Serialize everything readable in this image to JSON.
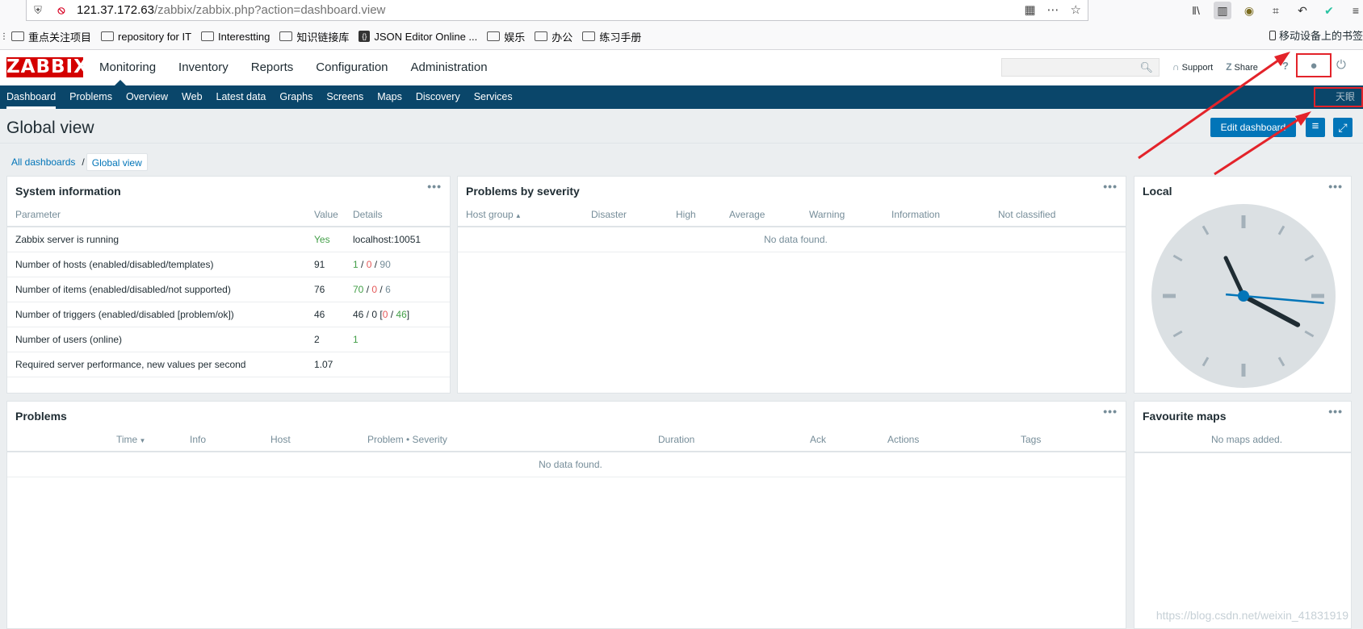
{
  "browser": {
    "url_host": "121.37.172.63",
    "url_path": "/zabbix/zabbix.php?action=dashboard.view",
    "bookmarks": [
      "重点关注项目",
      "repository for IT",
      "Interestting",
      "知识链接库",
      "JSON Editor Online ...",
      "娱乐",
      "办公",
      "练习手册"
    ],
    "mobile_bookmarks": "移动设备上的书签"
  },
  "header": {
    "logo": "ZABBIX",
    "menu": [
      "Monitoring",
      "Inventory",
      "Reports",
      "Configuration",
      "Administration"
    ],
    "support": "Support",
    "share": "Share",
    "help": "?"
  },
  "subnav": {
    "items": [
      "Dashboard",
      "Problems",
      "Overview",
      "Web",
      "Latest data",
      "Graphs",
      "Screens",
      "Maps",
      "Discovery",
      "Services"
    ],
    "server_name": "天眼"
  },
  "page": {
    "title": "Global view",
    "edit_button": "Edit dashboard",
    "breadcrumb": [
      "All dashboards",
      "Global view"
    ]
  },
  "system_info": {
    "title": "System information",
    "headers": [
      "Parameter",
      "Value",
      "Details"
    ],
    "rows": [
      {
        "param": "Zabbix server is running",
        "value": "Yes",
        "details": "localhost:10051"
      },
      {
        "param": "Number of hosts (enabled/disabled/templates)",
        "value": "91",
        "d1": "1",
        "d2": "0",
        "d3": "90"
      },
      {
        "param": "Number of items (enabled/disabled/not supported)",
        "value": "76",
        "d1": "70",
        "d2": "0",
        "d3": "6"
      },
      {
        "param": "Number of triggers (enabled/disabled [problem/ok])",
        "value": "46",
        "d0": "46 / 0 [",
        "d1": "0",
        "d2": "46",
        "d4": "]"
      },
      {
        "param": "Number of users (online)",
        "value": "2",
        "d1": "1"
      },
      {
        "param": "Required server performance, new values per second",
        "value": "1.07",
        "details": ""
      }
    ]
  },
  "problems_by_severity": {
    "title": "Problems by severity",
    "headers": [
      "Host group",
      "Disaster",
      "High",
      "Average",
      "Warning",
      "Information",
      "Not classified"
    ],
    "empty": "No data found."
  },
  "local_clock": {
    "title": "Local",
    "hour_angle_deg": 118,
    "minute_angle_deg": -25,
    "second_angle_deg": 95
  },
  "problems": {
    "title": "Problems",
    "headers": [
      "Time",
      "Info",
      "Host",
      "Problem • Severity",
      "Duration",
      "Ack",
      "Actions",
      "Tags"
    ],
    "empty": "No data found."
  },
  "favourite_maps": {
    "title": "Favourite maps",
    "empty": "No maps added."
  },
  "watermark": "https://blog.csdn.net/weixin_41831919",
  "colors": {
    "brand_red": "#d40000",
    "nav_blue": "#0a466a",
    "button_blue": "#0275b8",
    "ok_green": "#429e47",
    "problem_red": "#e45959",
    "annotation_red": "#e3232a"
  }
}
